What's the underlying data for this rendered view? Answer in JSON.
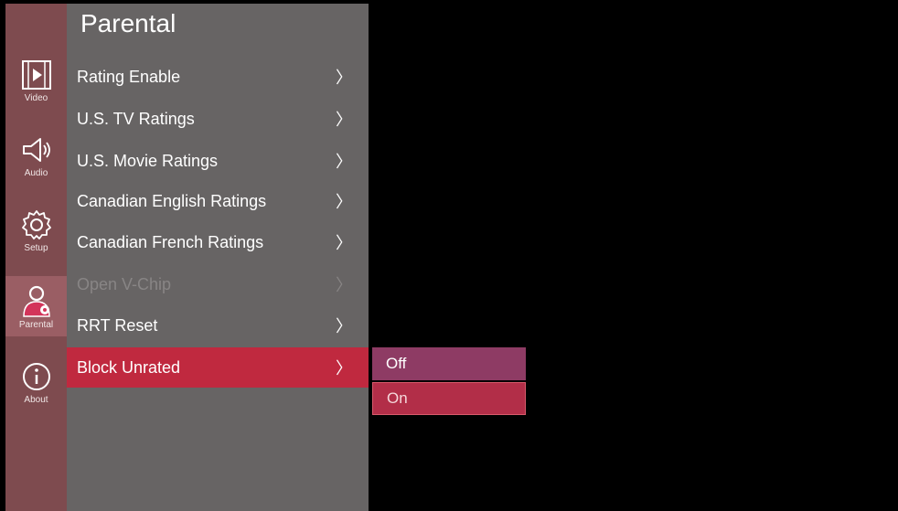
{
  "sidebar": {
    "items": [
      {
        "label": "Video",
        "icon": "video-icon"
      },
      {
        "label": "Audio",
        "icon": "speaker-icon"
      },
      {
        "label": "Setup",
        "icon": "gear-icon"
      },
      {
        "label": "Parental",
        "icon": "parental-user-icon",
        "active": true
      },
      {
        "label": "About",
        "icon": "info-icon"
      }
    ]
  },
  "panel": {
    "title": "Parental",
    "items": [
      {
        "label": "Rating Enable",
        "chevron": "〉"
      },
      {
        "label": "U.S. TV Ratings",
        "chevron": "〉"
      },
      {
        "label": "U.S. Movie Ratings",
        "chevron": "〉"
      },
      {
        "label": "Canadian English Ratings",
        "chevron": "〉"
      },
      {
        "label": "Canadian French Ratings",
        "chevron": "〉"
      },
      {
        "label": "Open V-Chip",
        "chevron": "〉",
        "disabled": true
      },
      {
        "label": "RRT Reset",
        "chevron": "〉"
      },
      {
        "label": "Block Unrated",
        "chevron": "〉",
        "selected": true
      }
    ]
  },
  "popup": {
    "options": [
      {
        "label": "Off",
        "focused": true
      },
      {
        "label": "On"
      }
    ]
  },
  "colors": {
    "sidebar_bg": "#7e4b4f",
    "panel_bg": "#676464",
    "selected_red": "#c0293f",
    "popup_focus": "#8e3b64"
  }
}
